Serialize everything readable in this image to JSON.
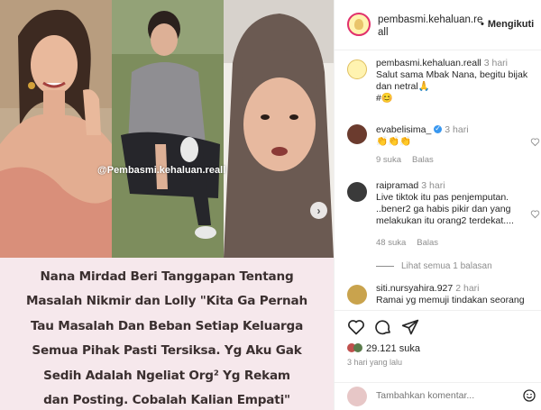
{
  "post": {
    "watermark": "@Pembasmi.kehaluan.reall",
    "caption_lines": [
      "Nana Mirdad Beri Tanggapan Tentang",
      "Masalah Nikmir dan Lolly \"Kita Ga Pernah",
      "Tau Masalah Dan Beban Setiap Keluarga",
      "Semua Pihak Pasti Tersiksa. Yg Aku Gak",
      "Sedih Adalah Ngeliat Org² Yg Rekam",
      "dan Posting. Cobalah Kalian Empati\""
    ]
  },
  "header": {
    "username": "pembasmi.kehaluan.re all",
    "follow_label": "Mengikuti",
    "dot": "•"
  },
  "comments": [
    {
      "user": "pembasmi.kehaluan.reall",
      "time": "3 hari",
      "text": "Salut sama Mbak Nana, begitu bijak dan netral🙏",
      "extra": "#😊"
    },
    {
      "user": "evabelisima_",
      "time": "3 hari",
      "text": "👏👏👏",
      "likes": "9 suka",
      "reply": "Balas",
      "verified": true
    },
    {
      "user": "raipramad",
      "time": "3 hari",
      "text": "Live tiktok itu pas penjemputan. ..bener2 ga habis pikir dan yang melakukan itu orang2 terdekat....",
      "likes": "48 suka",
      "reply": "Balas"
    },
    {
      "user": "siti.nursyahira.927",
      "time": "2 hari",
      "text": "Ramai yg memuji tindakan seorang"
    }
  ],
  "more_replies": "Lihat semua 1 balasan",
  "likes_count": "29.121 suka",
  "date": "3 hari yang lalu",
  "add_comment_placeholder": "Tambahkan komentar..."
}
